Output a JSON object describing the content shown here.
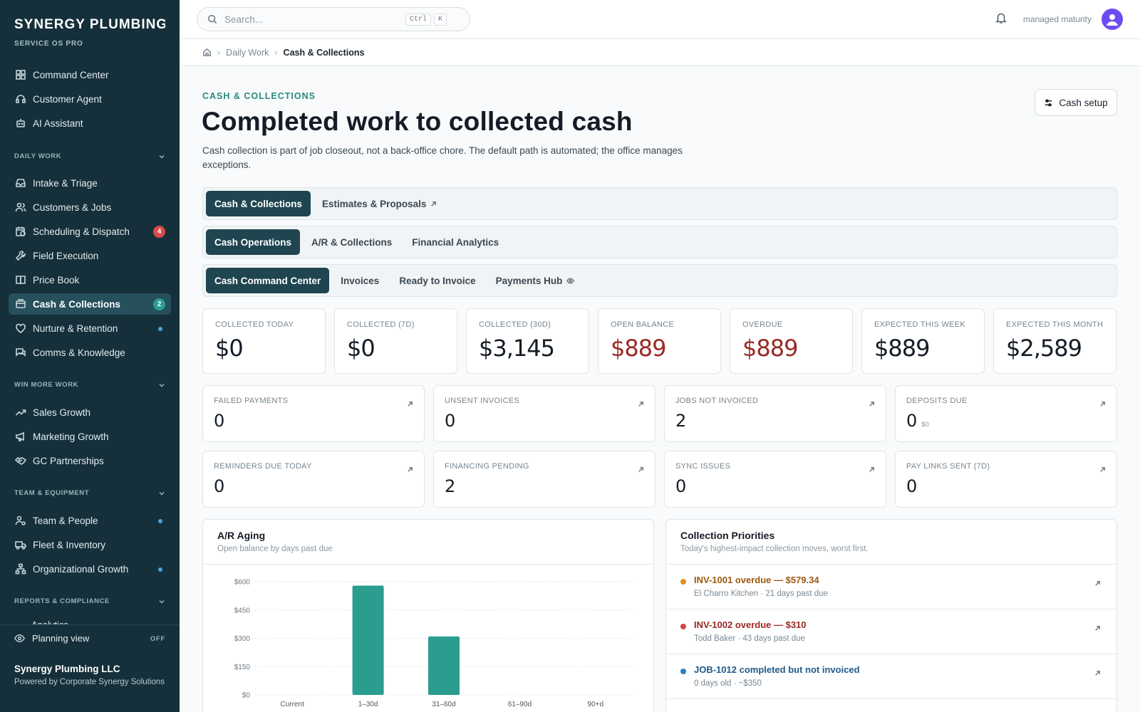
{
  "brand": {
    "name": "SYNERGY PLUMBING ...",
    "sub": "SERVICE OS PRO"
  },
  "sidebar": {
    "top_items": [
      {
        "label": "Command Center"
      },
      {
        "label": "Customer Agent"
      },
      {
        "label": "AI Assistant"
      }
    ],
    "sections": {
      "daily_work": "DAILY WORK",
      "win_more_work": "WIN MORE WORK",
      "team_equipment": "TEAM & EQUIPMENT",
      "reports": "REPORTS & COMPLIANCE"
    },
    "daily_items": [
      {
        "label": "Intake & Triage"
      },
      {
        "label": "Customers & Jobs"
      },
      {
        "label": "Scheduling & Dispatch",
        "badge": "4"
      },
      {
        "label": "Field Execution"
      },
      {
        "label": "Price Book"
      },
      {
        "label": "Cash & Collections",
        "badge": "2"
      },
      {
        "label": "Nurture & Retention"
      },
      {
        "label": "Comms & Knowledge"
      }
    ],
    "win_items": [
      {
        "label": "Sales Growth"
      },
      {
        "label": "Marketing Growth"
      },
      {
        "label": "GC Partnerships"
      }
    ],
    "team_items": [
      {
        "label": "Team & People"
      },
      {
        "label": "Fleet & Inventory"
      },
      {
        "label": "Organizational Growth"
      }
    ],
    "clipped_item": "Analytics",
    "planning_label": "Planning view",
    "planning_state": "OFF",
    "org_name": "Synergy Plumbing LLC",
    "org_sub": "Powered by Corporate Synergy Solutions"
  },
  "topbar": {
    "search_placeholder": "Search...",
    "kbd1": "Ctrl",
    "kbd2": "K",
    "user_label": "managed maturity"
  },
  "breadcrumb": {
    "section": "Daily Work",
    "current": "Cash & Collections"
  },
  "header": {
    "eyebrow": "CASH & COLLECTIONS",
    "title": "Completed work to collected cash",
    "description": "Cash collection is part of job closeout, not a back-office chore. The default path is automated; the office manages exceptions.",
    "setup_button": "Cash setup"
  },
  "tabs_l1": [
    {
      "label": "Cash & Collections"
    },
    {
      "label": "Estimates & Proposals"
    }
  ],
  "tabs_l2": [
    {
      "label": "Cash Operations"
    },
    {
      "label": "A/R & Collections"
    },
    {
      "label": "Financial Analytics"
    }
  ],
  "tabs_l3": [
    {
      "label": "Cash Command Center"
    },
    {
      "label": "Invoices"
    },
    {
      "label": "Ready to Invoice"
    },
    {
      "label": "Payments Hub"
    }
  ],
  "kpis": [
    {
      "label": "COLLECTED TODAY",
      "value": "$0"
    },
    {
      "label": "COLLECTED (7D)",
      "value": "$0"
    },
    {
      "label": "COLLECTED (30D)",
      "value": "$3,145"
    },
    {
      "label": "OPEN BALANCE",
      "value": "$889"
    },
    {
      "label": "OVERDUE",
      "value": "$889"
    },
    {
      "label": "EXPECTED THIS WEEK",
      "value": "$889"
    },
    {
      "label": "EXPECTED THIS MONTH",
      "value": "$2,589"
    }
  ],
  "metrics": [
    {
      "label": "FAILED PAYMENTS",
      "value": "0"
    },
    {
      "label": "UNSENT INVOICES",
      "value": "0"
    },
    {
      "label": "JOBS NOT INVOICED",
      "value": "2"
    },
    {
      "label": "DEPOSITS DUE",
      "value": "0",
      "sub": "$0"
    },
    {
      "label": "REMINDERS DUE TODAY",
      "value": "0"
    },
    {
      "label": "FINANCING PENDING",
      "value": "2"
    },
    {
      "label": "SYNC ISSUES",
      "value": "0"
    },
    {
      "label": "PAY LINKS SENT (7D)",
      "value": "0"
    }
  ],
  "aging": {
    "title": "A/R Aging",
    "subtitle": "Open balance by days past due"
  },
  "chart_data": {
    "type": "bar",
    "categories": [
      "Current",
      "1–30d",
      "31–60d",
      "61–90d",
      "90+d"
    ],
    "values": [
      0,
      579.34,
      310,
      0,
      0
    ],
    "ylim": [
      0,
      600
    ],
    "yticks": [
      "$0",
      "$150",
      "$300",
      "$450",
      "$600"
    ],
    "ytick_values": [
      0,
      150,
      300,
      450,
      600
    ],
    "grid": true,
    "color": "#2a9d8f"
  },
  "priorities": {
    "title": "Collection Priorities",
    "subtitle": "Today's highest-impact collection moves, worst first.",
    "items": [
      {
        "title": "INV-1001 overdue — $579.34",
        "sub": "El Charro Kitchen · 21 days past due",
        "color": "#e0902a",
        "text_color": "#9a5a10"
      },
      {
        "title": "INV-1002 overdue — $310",
        "sub": "Todd Baker · 43 days past due",
        "color": "#d64545",
        "text_color": "#9a2a25"
      },
      {
        "title": "JOB-1012 completed but not invoiced",
        "sub": "0 days old · ~$350",
        "color": "#2f7fc0",
        "text_color": "#1f5a8a"
      }
    ]
  }
}
